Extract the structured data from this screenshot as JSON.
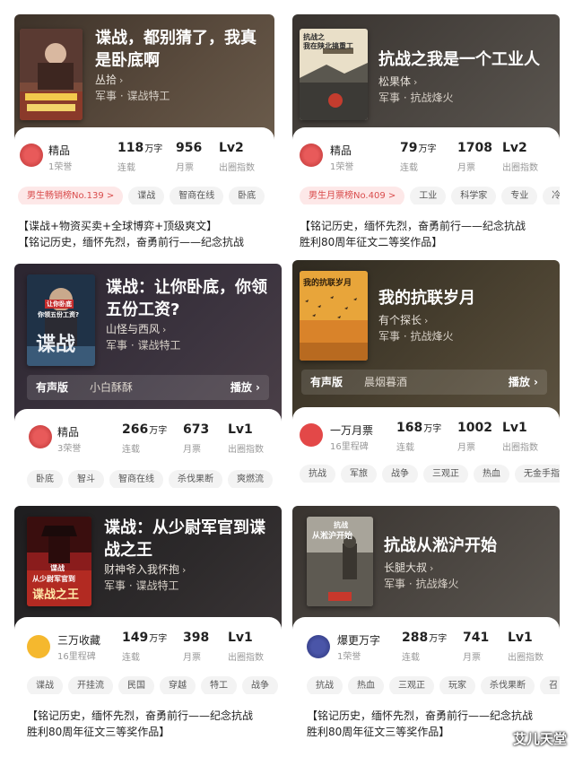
{
  "cards": [
    {
      "title": "谍战，都别猜了，我真是卧底啊",
      "author": "丛拾",
      "genre": "军事 · 谍战特工",
      "badge_main": "精品",
      "badge_sub": "1荣誉",
      "stats": [
        {
          "value": "118",
          "unit": "万字",
          "label": "连载"
        },
        {
          "value": "956",
          "unit": "",
          "label": "月票"
        },
        {
          "value": "Lv2",
          "unit": "",
          "label": "出圈指数"
        }
      ],
      "tags": [
        "男生畅销榜No.139 >",
        "谍战",
        "智商在线",
        "卧底"
      ],
      "desc": [
        "【谍战+物资买卖+全球博弈+顶级爽文】",
        "【铭记历史，缅怀先烈，奋勇前行——纪念抗战"
      ]
    },
    {
      "title": "抗战之我是一个工业人",
      "author": "松果体",
      "genre": "军事 · 抗战烽火",
      "cover_text": [
        "抗战之",
        "我在陕北搞重工"
      ],
      "badge_main": "精品",
      "badge_sub": "1荣誉",
      "stats": [
        {
          "value": "79",
          "unit": "万字",
          "label": "连载"
        },
        {
          "value": "1708",
          "unit": "",
          "label": "月票"
        },
        {
          "value": "Lv2",
          "unit": "",
          "label": "出圈指数"
        }
      ],
      "tags": [
        "男生月票榜No.409 >",
        "工业",
        "科学家",
        "专业",
        "冷"
      ],
      "desc": [
        "【铭记历史，缅怀先烈，奋勇前行——纪念抗战",
        "胜利80周年征文二等奖作品】"
      ]
    },
    {
      "title": "谍战：让你卧底，你领五份工资?",
      "author": "山怪与西风",
      "genre": "军事 · 谍战特工",
      "cover_text": [
        "让你卧底",
        "你领五份工资?",
        "谍战"
      ],
      "audio_tag": "有声版",
      "audio_narrator": "小白酥酥",
      "audio_play": "播放",
      "badge_main": "精品",
      "badge_sub": "3荣誉",
      "stats": [
        {
          "value": "266",
          "unit": "万字",
          "label": "连载"
        },
        {
          "value": "673",
          "unit": "",
          "label": "月票"
        },
        {
          "value": "Lv1",
          "unit": "",
          "label": "出圈指数"
        }
      ],
      "tags": [
        "卧底",
        "智斗",
        "智商在线",
        "杀伐果断",
        "爽燃流"
      ]
    },
    {
      "title": "我的抗联岁月",
      "author": "有个探长",
      "genre": "军事 · 抗战烽火",
      "cover_text": [
        "我的抗联岁月"
      ],
      "audio_tag": "有声版",
      "audio_narrator": "晨烟暮酒",
      "audio_play": "播放",
      "badge_main": "一万月票",
      "badge_sub": "16里程碑",
      "stats": [
        {
          "value": "168",
          "unit": "万字",
          "label": "连载"
        },
        {
          "value": "1002",
          "unit": "",
          "label": "月票"
        },
        {
          "value": "Lv1",
          "unit": "",
          "label": "出圈指数"
        }
      ],
      "tags": [
        "抗战",
        "军旅",
        "战争",
        "三观正",
        "热血",
        "无金手指"
      ]
    },
    {
      "title": "谍战：从少尉军官到谍战之王",
      "author": "财神爷入我怀抱",
      "genre": "军事 · 谍战特工",
      "cover_text": [
        "谍战",
        "从少尉军官到",
        "谍战之王"
      ],
      "badge_main": "三万收藏",
      "badge_sub": "16里程碑",
      "stats": [
        {
          "value": "149",
          "unit": "万字",
          "label": "连载"
        },
        {
          "value": "398",
          "unit": "",
          "label": "月票"
        },
        {
          "value": "Lv1",
          "unit": "",
          "label": "出圈指数"
        }
      ],
      "tags": [
        "谍战",
        "开挂流",
        "民国",
        "穿越",
        "特工",
        "战争"
      ],
      "desc": [
        "【铭记历史，缅怀先烈，奋勇前行——纪念抗战",
        "胜利80周年征文三等奖作品】"
      ]
    },
    {
      "title": "抗战从淞沪开始",
      "author": "长腿大叔",
      "genre": "军事 · 抗战烽火",
      "cover_text": [
        "抗战",
        "从淞沪开始"
      ],
      "badge_main": "爆更万字",
      "badge_sub": "1荣誉",
      "stats": [
        {
          "value": "288",
          "unit": "万字",
          "label": "连载"
        },
        {
          "value": "741",
          "unit": "",
          "label": "月票"
        },
        {
          "value": "Lv1",
          "unit": "",
          "label": "出圈指数"
        }
      ],
      "tags": [
        "抗战",
        "热血",
        "三观正",
        "玩家",
        "杀伐果断",
        "召"
      ],
      "desc": [
        "【铭记历史，缅怀先烈，奋勇前行——纪念抗战",
        "胜利80周年征文三等奖作品】"
      ]
    }
  ],
  "watermark": "艾儿天堂",
  "colors": {
    "rank_tag_bg": "#fde8e8",
    "rank_tag_text": "#d94c4c"
  }
}
